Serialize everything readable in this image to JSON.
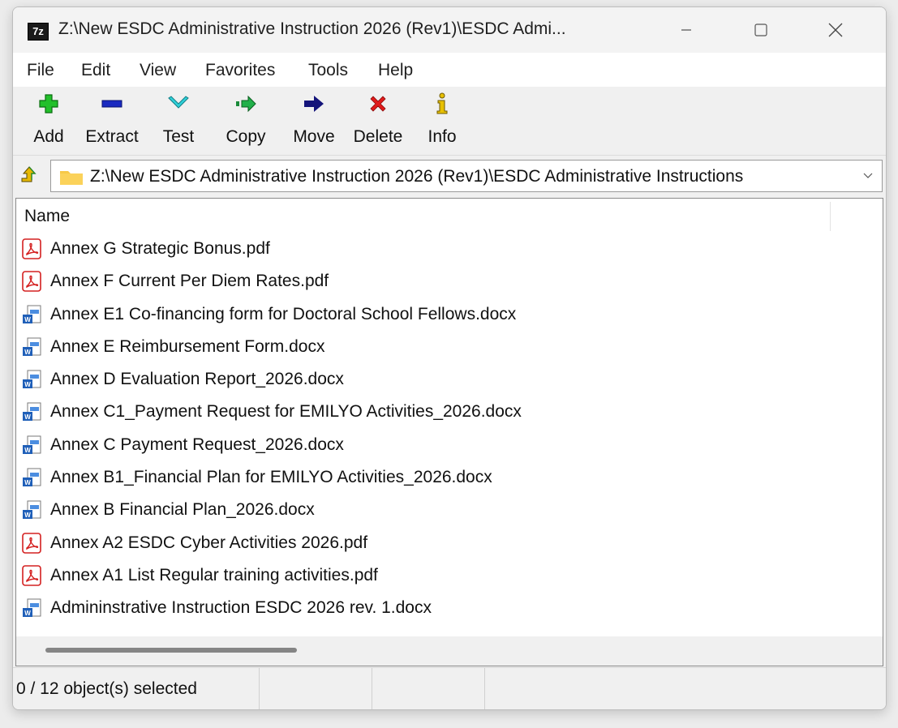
{
  "window": {
    "title": "Z:\\New ESDC Administrative Instruction 2026 (Rev1)\\ESDC Admi...",
    "app_icon_text": "7z",
    "controls": {
      "minimize": "minimize-icon",
      "maximize": "maximize-icon",
      "close": "close-icon"
    }
  },
  "menu": [
    "File",
    "Edit",
    "View",
    "Favorites",
    "Tools",
    "Help"
  ],
  "toolbar": [
    {
      "label": "Add",
      "icon": "add-icon",
      "color": "#22c02a"
    },
    {
      "label": "Extract",
      "icon": "extract-icon",
      "color": "#1a2ac0"
    },
    {
      "label": "Test",
      "icon": "test-icon",
      "color": "#2fd0d8"
    },
    {
      "label": "Copy",
      "icon": "copy-icon",
      "color": "#1a8a3a"
    },
    {
      "label": "Move",
      "icon": "move-icon",
      "color": "#14147a"
    },
    {
      "label": "Delete",
      "icon": "delete-icon",
      "color": "#e01b1b"
    },
    {
      "label": "Info",
      "icon": "info-icon",
      "color": "#c9a400"
    }
  ],
  "address": {
    "path": "Z:\\New ESDC Administrative Instruction 2026 (Rev1)\\ESDC Administrative Instructions"
  },
  "list": {
    "column_name": "Name",
    "files": [
      {
        "name": "Annex G Strategic Bonus.pdf",
        "type": "pdf"
      },
      {
        "name": "Annex F Current Per Diem Rates.pdf",
        "type": "pdf"
      },
      {
        "name": "Annex E1 Co-financing form for Doctoral School Fellows.docx",
        "type": "docx"
      },
      {
        "name": "Annex E Reimbursement Form.docx",
        "type": "docx"
      },
      {
        "name": "Annex D Evaluation Report_2026.docx",
        "type": "docx"
      },
      {
        "name": "Annex C1_Payment Request for EMILYO Activities_2026.docx",
        "type": "docx"
      },
      {
        "name": "Annex C Payment Request_2026.docx",
        "type": "docx"
      },
      {
        "name": "Annex B1_Financial Plan for EMILYO Activities_2026.docx",
        "type": "docx"
      },
      {
        "name": "Annex B Financial Plan_2026.docx",
        "type": "docx"
      },
      {
        "name": "Annex A2 ESDC Cyber Activities 2026.pdf",
        "type": "pdf"
      },
      {
        "name": "Annex A1 List Regular training activities.pdf",
        "type": "pdf"
      },
      {
        "name": "Admininstrative Instruction ESDC 2026 rev. 1.docx",
        "type": "docx"
      }
    ]
  },
  "status": {
    "selection": "0 / 12 object(s) selected"
  }
}
